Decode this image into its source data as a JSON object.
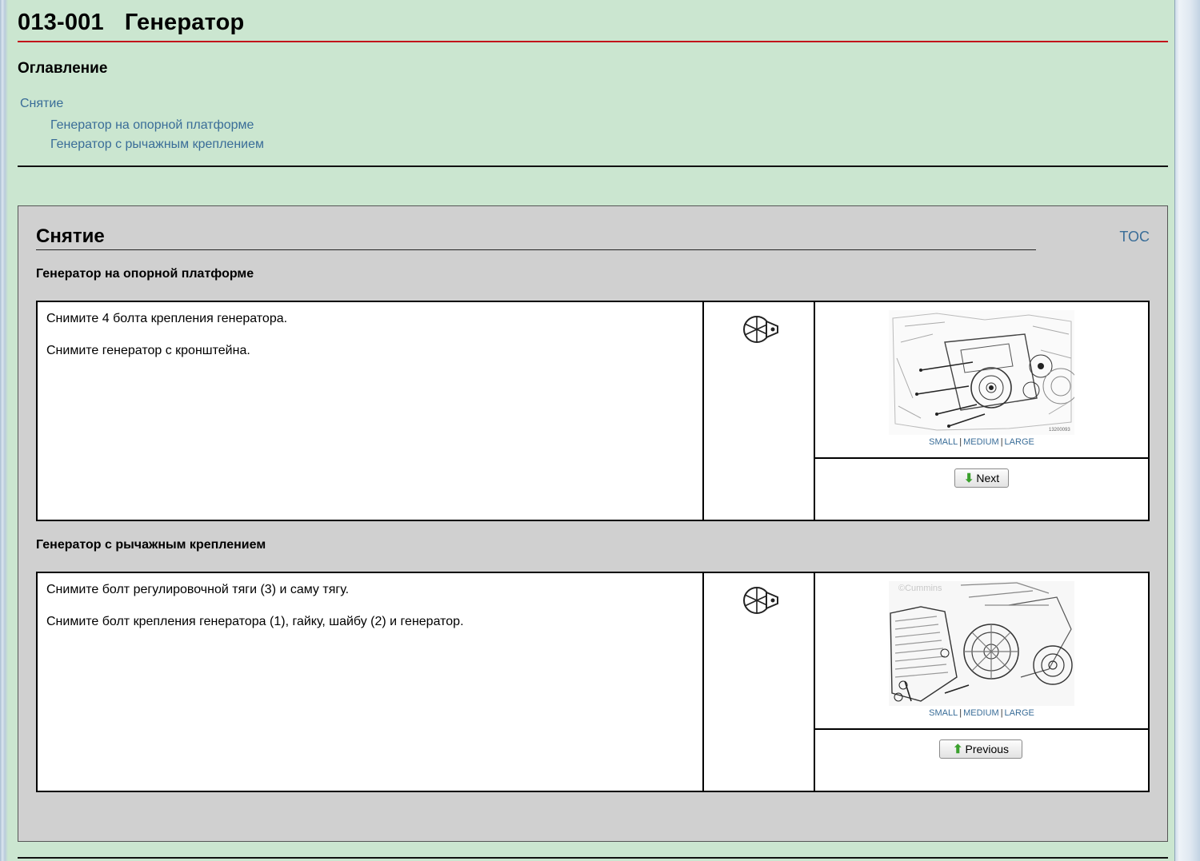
{
  "header": {
    "code": "013-001",
    "title": "Генератор"
  },
  "toc": {
    "heading": "Оглавление",
    "items": [
      {
        "label": "Снятие"
      },
      {
        "label": "Генератор на опорной платформе"
      },
      {
        "label": "Генератор с рычажным креплением"
      }
    ]
  },
  "section": {
    "title": "Снятие",
    "toc_link": "TOC",
    "steps": [
      {
        "heading": "Генератор на опорной платформе",
        "lines": [
          "Снимите 4 болта крепления генератора.",
          "Снимите генератор с кронштейна."
        ],
        "tool_icon": "wrench-wheel-icon",
        "image_sizes": [
          "SMALL",
          "MEDIUM",
          "LARGE"
        ],
        "image_caption": "13200093",
        "nav_button": "Next",
        "nav_icon": "arrow-down-icon"
      },
      {
        "heading": "Генератор с рычажным креплением",
        "lines": [
          "Снимите болт регулировочной тяги (3) и саму тягу.",
          "Снимите болт крепления генератора (1), гайку, шайбу (2) и генератор."
        ],
        "tool_icon": "wrench-wheel-icon",
        "image_watermark": "©Cummins",
        "image_sizes": [
          "SMALL",
          "MEDIUM",
          "LARGE"
        ],
        "nav_button": "Previous",
        "nav_icon": "arrow-up-icon"
      }
    ]
  }
}
